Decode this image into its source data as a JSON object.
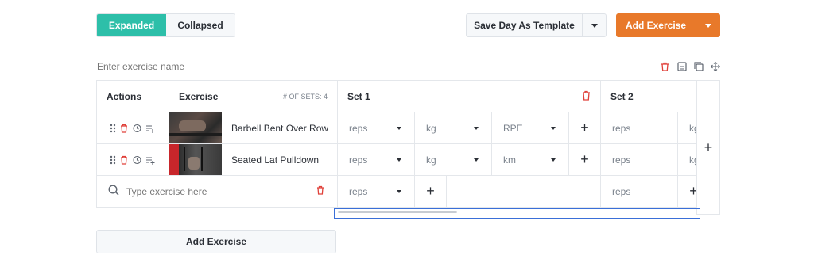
{
  "view_toggle": {
    "expanded": "Expanded",
    "collapsed": "Collapsed"
  },
  "toolbar": {
    "save_template": "Save Day As Template",
    "add_exercise": "Add Exercise"
  },
  "search": {
    "placeholder": "Enter exercise name"
  },
  "table": {
    "header": {
      "actions": "Actions",
      "exercise": "Exercise",
      "sets_count": "# OF SETS: 4",
      "set1": "Set 1",
      "set2": "Set 2"
    },
    "rows": [
      {
        "name": "Barbell Bent Over Row",
        "c1": "reps",
        "c2": "kg",
        "c3": "RPE",
        "s2": "reps",
        "s2b": "kg"
      },
      {
        "name": "Seated Lat Pulldown",
        "c1": "reps",
        "c2": "kg",
        "c3": "km",
        "s2": "reps",
        "s2b": "kg"
      }
    ],
    "new_row": {
      "placeholder": "Type exercise here",
      "c1": "reps",
      "s2": "reps"
    }
  },
  "bottom": {
    "add_exercise": "Add Exercise"
  },
  "colors": {
    "accent": "#2dbfa9",
    "primary": "#e8792a",
    "danger": "#e0413a"
  }
}
